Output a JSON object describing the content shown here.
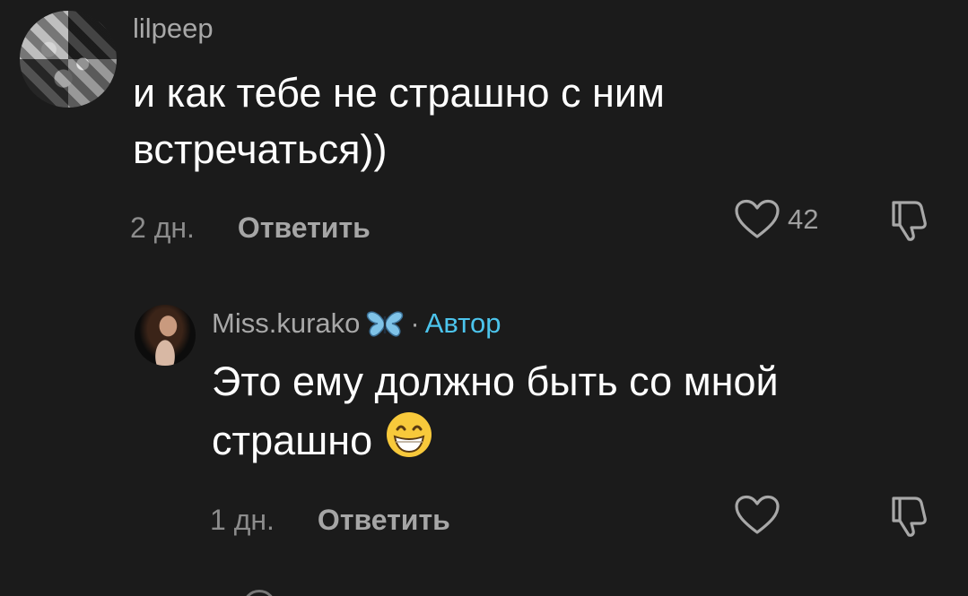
{
  "comments": [
    {
      "username": "lilpeep",
      "text": "и как тебе не страшно с ним встречаться))",
      "time": "2 дн.",
      "reply_label": "Ответить",
      "likes": "42",
      "avatar_icon": "avatar-image"
    },
    {
      "username": "Miss.kurako",
      "badge_icon": "butterfly-emoji-icon",
      "separator": "·",
      "author_label": "Автор",
      "text": "Это ему должно быть со мной страшно",
      "text_emoji_icon": "grinning-face-emoji-icon",
      "time": "1 дн.",
      "reply_label": "Ответить",
      "likes": "",
      "avatar_icon": "avatar-image"
    }
  ],
  "colors": {
    "background": "#1b1b1b",
    "text": "#ffffff",
    "muted": "#a8a8a8",
    "author": "#4cc4ec"
  }
}
